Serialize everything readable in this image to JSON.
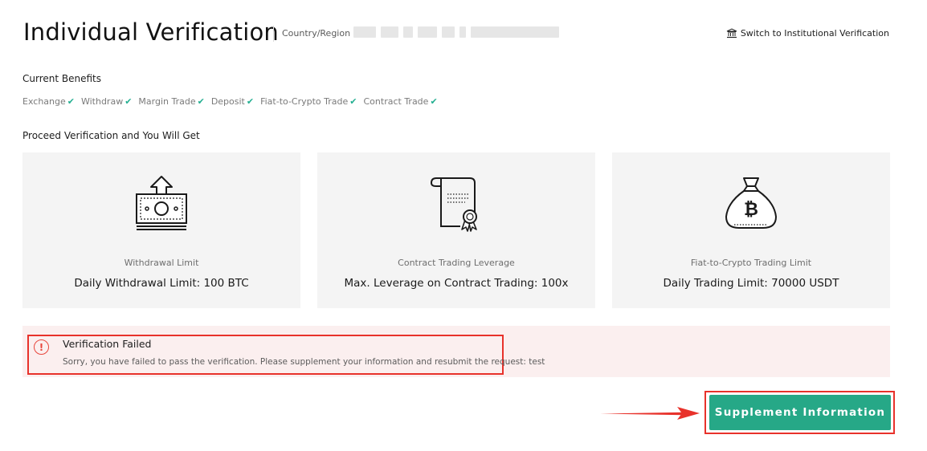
{
  "header": {
    "title": "Individual Verification",
    "country_label": "Country/Region :",
    "switch_label": "Switch to Institutional Verification"
  },
  "current_benefits": {
    "title": "Current Benefits",
    "items": [
      {
        "label": "Exchange"
      },
      {
        "label": "Withdraw"
      },
      {
        "label": "Margin Trade"
      },
      {
        "label": "Deposit"
      },
      {
        "label": "Fiat-to-Crypto Trade"
      },
      {
        "label": "Contract Trade"
      }
    ]
  },
  "proceed": {
    "title": "Proceed Verification and You Will Get",
    "cards": [
      {
        "icon": "withdraw-cash-icon",
        "caption": "Withdrawal Limit",
        "value": "Daily Withdrawal Limit: 100 BTC"
      },
      {
        "icon": "certificate-icon",
        "caption": "Contract Trading Leverage",
        "value": "Max. Leverage on Contract Trading: 100x"
      },
      {
        "icon": "bitcoin-bag-icon",
        "caption": "Fiat-to-Crypto Trading Limit",
        "value": "Daily Trading Limit: 70000 USDT"
      }
    ]
  },
  "alert": {
    "title": "Verification Failed",
    "message": "Sorry, you have failed to pass the verification. Please supplement your information and resubmit the request: test"
  },
  "actions": {
    "supplement_label": "Supplement Information"
  },
  "colors": {
    "accent": "#26a887",
    "check": "#23af91",
    "error": "#e8322b",
    "alert_bg": "#fbefef",
    "card_bg": "#f4f4f4"
  }
}
